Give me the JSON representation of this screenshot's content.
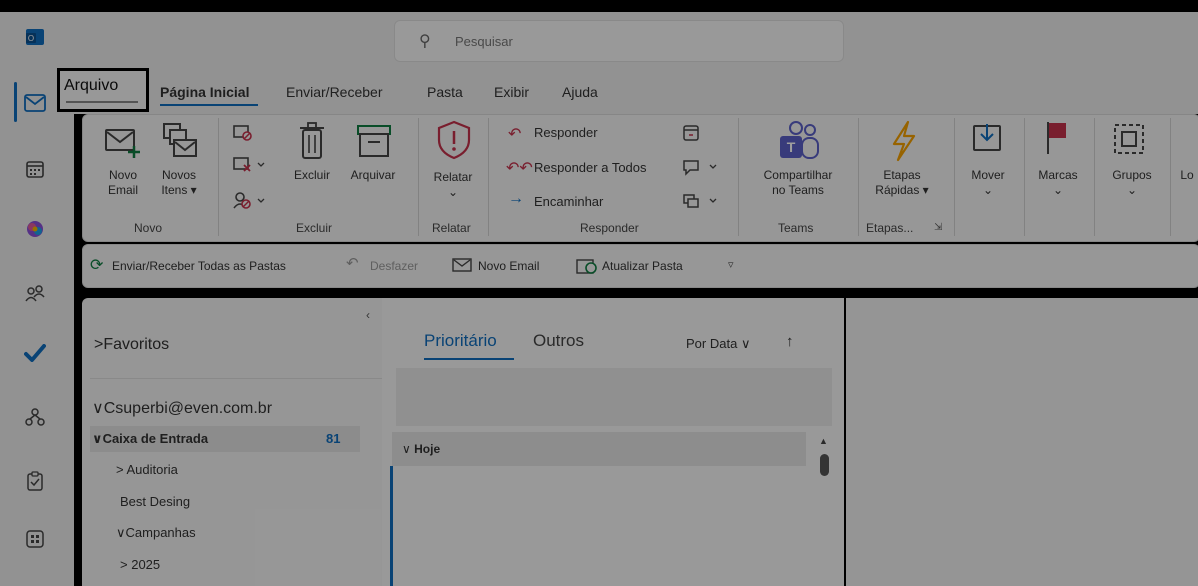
{
  "search": {
    "placeholder": "Pesquisar"
  },
  "menu": {
    "tabs": [
      "Arquivo",
      "Página Inicial",
      "Enviar/Receber",
      "Pasta",
      "Exibir",
      "Ajuda"
    ]
  },
  "ribbon": {
    "groups": {
      "novo": {
        "label": "Novo",
        "novo_email": [
          "Novo",
          "Email"
        ],
        "novos_itens": [
          "Novos",
          "Itens ▾"
        ]
      },
      "excluir": {
        "label": "Excluir",
        "excluir": "Excluir",
        "arquivar": "Arquivar"
      },
      "relatar": {
        "label": "Relatar",
        "relatar": "Relatar"
      },
      "responder": {
        "label": "Responder",
        "responder": "Responder",
        "responder_todos": "Responder a Todos",
        "encaminhar": "Encaminhar"
      },
      "teams": {
        "label": "Teams",
        "compartilhar": [
          "Compartilhar",
          "no Teams"
        ]
      },
      "etapas": {
        "label": "Etapas...",
        "etapas_rapidas": [
          "Etapas",
          "Rápidas ▾"
        ]
      },
      "mover": {
        "label": "Mover"
      },
      "marcas": {
        "label": "Marcas"
      },
      "grupos": {
        "label": "Grupos"
      },
      "lo": {
        "label": "Lo"
      }
    }
  },
  "quickbar": {
    "enviar_receber": "Enviar/Receber Todas as Pastas",
    "desfazer": "Desfazer",
    "novo_email": "Novo Email",
    "atualizar": "Atualizar Pasta"
  },
  "folders": {
    "favoritos": "Favoritos",
    "account": "Csuperbi@even.com.br",
    "inbox": "Caixa de Entrada",
    "inbox_count": "81",
    "items": [
      "Auditoria",
      "Best Desing",
      "Campanhas",
      "2025"
    ]
  },
  "messages": {
    "tab_priority": "Prioritário",
    "tab_others": "Outros",
    "sort": "Por Data",
    "group_today": "Hoje"
  },
  "colors": {
    "accent": "#0f6cbd",
    "outlook_blue": "#0f6cbd",
    "red_icon": "#c4314b",
    "green_icon": "#107c41"
  }
}
